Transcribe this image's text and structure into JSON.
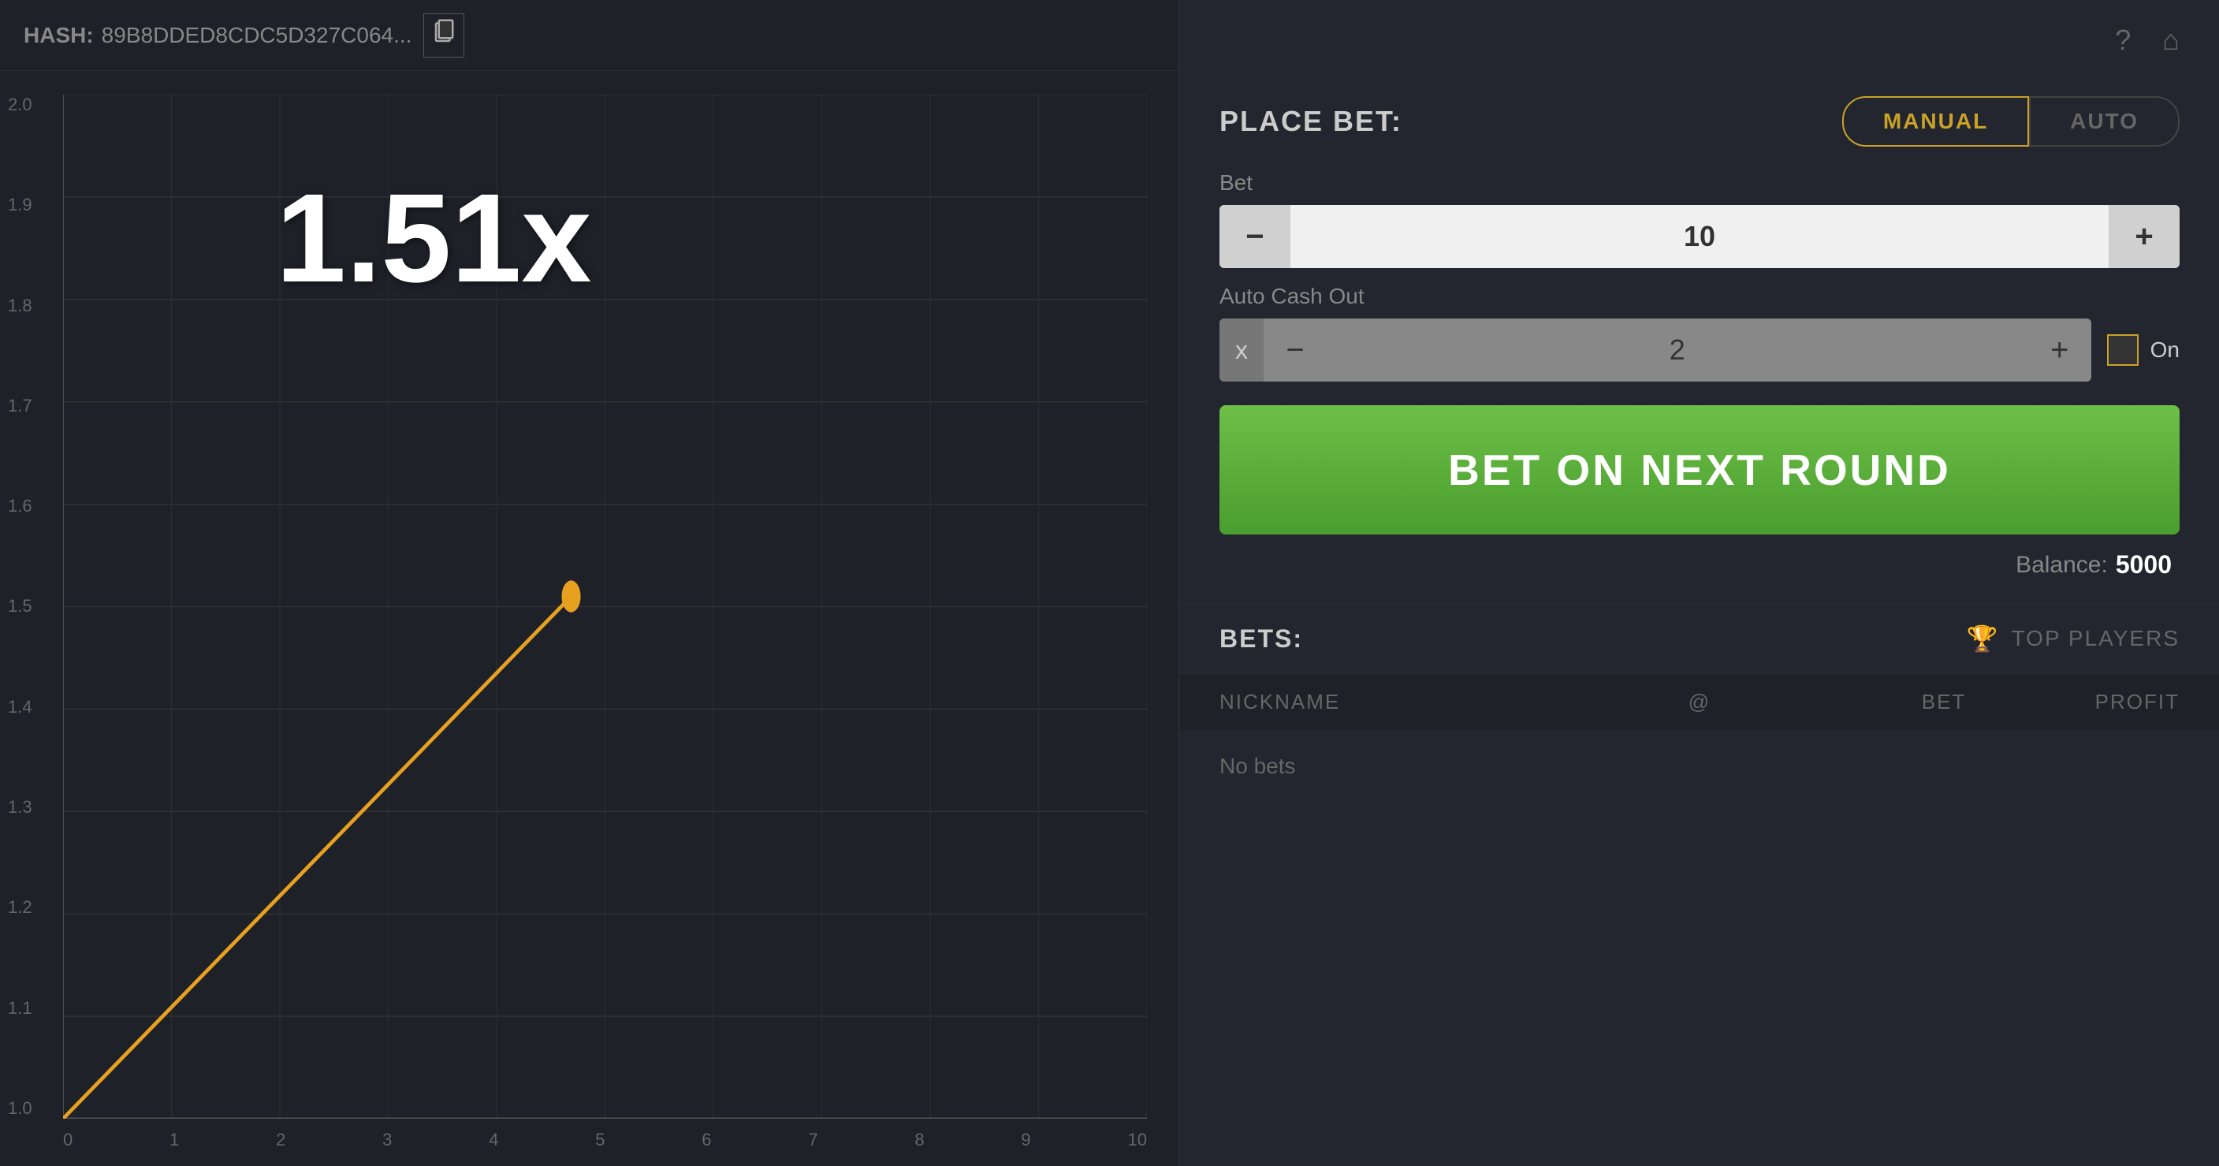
{
  "hash": {
    "label": "HASH:",
    "value": "89B8DDED8CDC5D327C064...",
    "copy_tooltip": "Copy"
  },
  "chart": {
    "multiplier": "1.51x",
    "y_labels": [
      "2.0",
      "1.9",
      "1.8",
      "1.7",
      "1.6",
      "1.5",
      "1.4",
      "1.3",
      "1.2",
      "1.1",
      "1.0"
    ],
    "x_labels": [
      "0",
      "1",
      "2",
      "3",
      "4",
      "5",
      "6",
      "7",
      "8",
      "9",
      "10"
    ]
  },
  "header_icons": {
    "help": "?",
    "home": "⌂"
  },
  "place_bet": {
    "title": "PLACE BET:",
    "manual_label": "MANUAL",
    "auto_label": "AUTO"
  },
  "bet": {
    "label": "Bet",
    "value": "10",
    "minus": "−",
    "plus": "+"
  },
  "auto_cashout": {
    "label": "Auto Cash Out",
    "x_prefix": "x",
    "value": "2",
    "minus": "−",
    "plus": "+",
    "toggle_label": "On"
  },
  "bet_button": {
    "label": "BET ON NEXT ROUND"
  },
  "balance": {
    "label": "Balance:",
    "value": "5000"
  },
  "bets": {
    "title": "BETS:",
    "top_players_label": "TOP PLAYERS",
    "columns": {
      "nickname": "NICKNAME",
      "at": "@",
      "bet": "BET",
      "profit": "PROFIT"
    },
    "empty_message": "No bets"
  }
}
